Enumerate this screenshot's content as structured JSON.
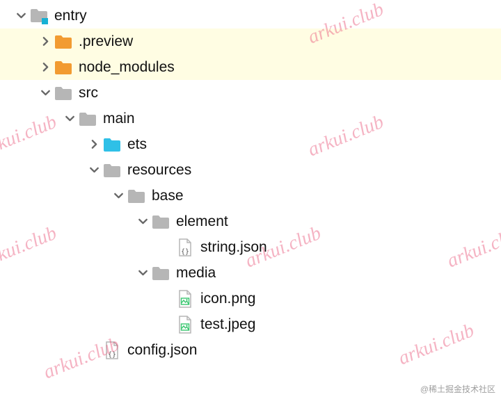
{
  "watermark_text": "arkui.club",
  "credit": "@稀土掘金技术社区",
  "tree": {
    "items": [
      {
        "depth": 0,
        "chevron": "down",
        "icon": "module-folder",
        "label": "entry",
        "hl": false
      },
      {
        "depth": 1,
        "chevron": "right",
        "icon": "folder-orange",
        "label": ".preview",
        "hl": true
      },
      {
        "depth": 1,
        "chevron": "right",
        "icon": "folder-orange",
        "label": "node_modules",
        "hl": true
      },
      {
        "depth": 1,
        "chevron": "down",
        "icon": "folder-gray",
        "label": "src",
        "hl": false
      },
      {
        "depth": 2,
        "chevron": "down",
        "icon": "folder-gray",
        "label": "main",
        "hl": false
      },
      {
        "depth": 3,
        "chevron": "right",
        "icon": "folder-cyan",
        "label": "ets",
        "hl": false
      },
      {
        "depth": 3,
        "chevron": "down",
        "icon": "folder-gray",
        "label": "resources",
        "hl": false
      },
      {
        "depth": 4,
        "chevron": "down",
        "icon": "folder-gray",
        "label": "base",
        "hl": false
      },
      {
        "depth": 5,
        "chevron": "down",
        "icon": "folder-gray",
        "label": "element",
        "hl": false
      },
      {
        "depth": 6,
        "chevron": "none",
        "icon": "json-file",
        "label": "string.json",
        "hl": false
      },
      {
        "depth": 5,
        "chevron": "down",
        "icon": "folder-gray",
        "label": "media",
        "hl": false
      },
      {
        "depth": 6,
        "chevron": "none",
        "icon": "image-file",
        "label": "icon.png",
        "hl": false
      },
      {
        "depth": 6,
        "chevron": "none",
        "icon": "image-file",
        "label": "test.jpeg",
        "hl": false
      },
      {
        "depth": 3,
        "chevron": "none",
        "icon": "json-file",
        "label": "config.json",
        "hl": false
      }
    ]
  },
  "icons": {
    "colors": {
      "folder-gray": "#b6b6b6",
      "folder-orange": "#f29b31",
      "folder-cyan": "#2fc0e7"
    }
  }
}
